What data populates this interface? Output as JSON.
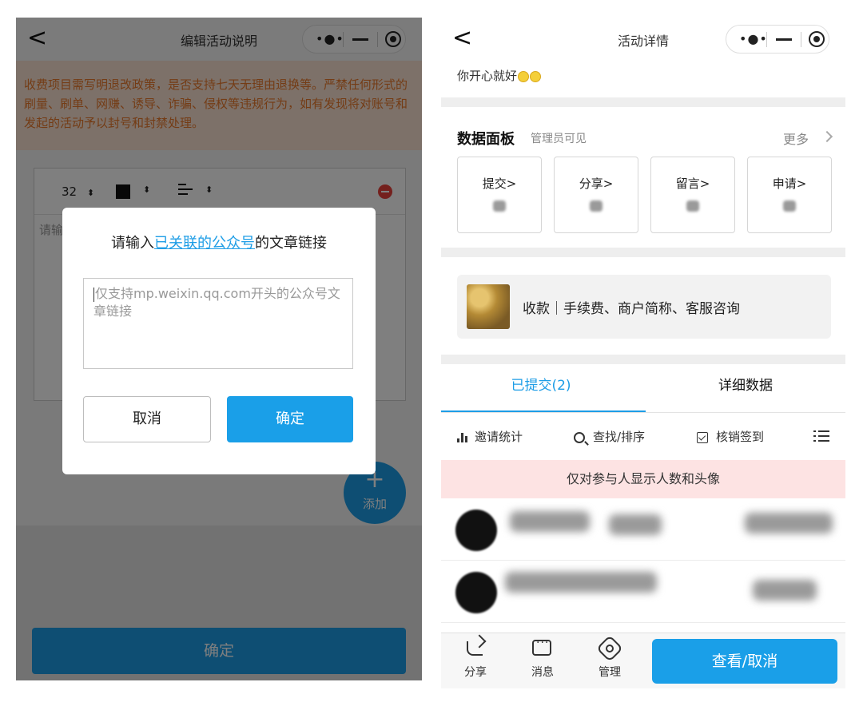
{
  "left": {
    "nav_title": "编辑活动说明",
    "back_glyph": "<",
    "notice": "收费项目需写明退改政策，是否支持七天无理由退换等。严禁任何形式的刷量、刷单、网赚、诱导、诈骗、侵权等违规行为，如有发现将对账号和发起的活动予以封号和封禁处理。",
    "toolbar": {
      "font_size": "32",
      "arrow": "⬍"
    },
    "editor_placeholder": "请输",
    "fab": {
      "plus": "+",
      "label": "添加"
    },
    "confirm": "确定",
    "dialog": {
      "title_prefix": "请输入",
      "title_link": "已关联的公众号",
      "title_suffix": "的文章链接",
      "input_placeholder": "仅支持mp.weixin.qq.com开头的公众号文章链接",
      "cancel": "取消",
      "ok": "确定"
    }
  },
  "right": {
    "nav_title": "活动详情",
    "back_glyph": "<",
    "greeting": "你开心就好",
    "panel": {
      "title": "数据面板",
      "subtitle": "管理员可见",
      "more": "更多",
      "stats": [
        {
          "label": "提交>"
        },
        {
          "label": "分享>"
        },
        {
          "label": "留言>"
        },
        {
          "label": "申请>"
        }
      ]
    },
    "payment": "收款｜手续费、商户简称、客服咨询",
    "tabs": {
      "submitted": "已提交(2)",
      "details": "详细数据"
    },
    "actions": {
      "invite": "邀请统计",
      "search": "查找/排序",
      "verify": "核销签到"
    },
    "notice": "仅对参与人显示人数和头像",
    "tabbar": {
      "share": "分享",
      "message": "消息",
      "manage": "管理",
      "view_cancel": "查看/取消"
    }
  },
  "colors": {
    "accent": "#1d9de6",
    "warning_text": "#e8782a",
    "notice_bg": "#fde3e3"
  },
  "icons": [
    "back-icon",
    "more-dots-icon",
    "minimize-icon",
    "close-target-icon",
    "remove-icon",
    "plus-icon",
    "chevron-right-icon",
    "bar-chart-icon",
    "search-icon",
    "checkbox-icon",
    "list-icon",
    "share-icon",
    "message-icon",
    "gear-icon"
  ]
}
